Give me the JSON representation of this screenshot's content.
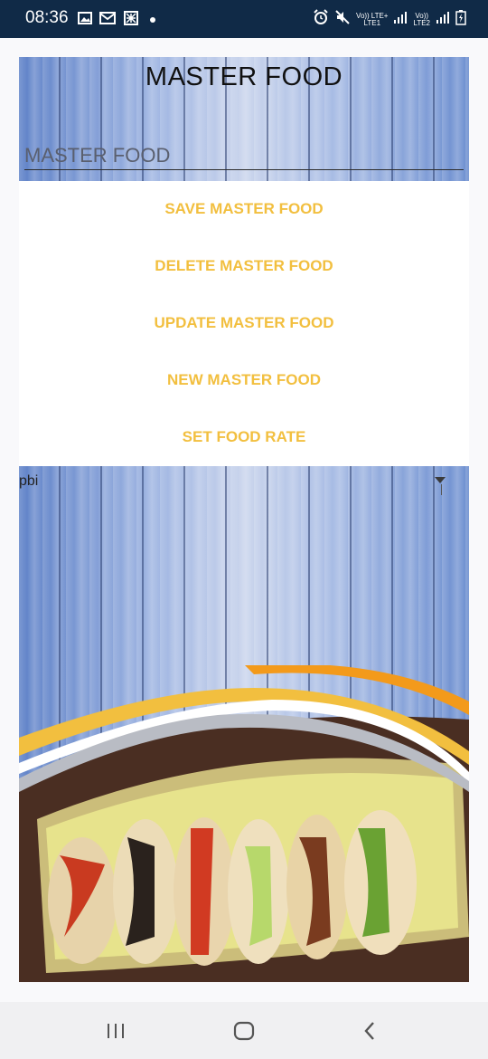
{
  "status_bar": {
    "time": "08:36",
    "icons": [
      "image-icon",
      "gmail-icon",
      "qr-icon",
      "dot-icon"
    ],
    "right_icons": [
      "alarm-icon",
      "mute-icon",
      "volte-lte1-icon",
      "signal-icon",
      "volte-lte2-icon",
      "signal-icon",
      "battery-charging-icon"
    ],
    "volte1_top": "Vo))",
    "volte1_mid": "LTE+",
    "volte1_bot": "LTE1",
    "volte2_top": "Vo))",
    "volte2_bot": "LTE2"
  },
  "header": {
    "title": "MASTER FOOD",
    "input_placeholder": "MASTER FOOD",
    "input_value": ""
  },
  "buttons": {
    "save": "SAVE MASTER FOOD",
    "delete": "DELETE MASTER FOOD",
    "update": "UPDATE MASTER FOOD",
    "new": "NEW MASTER FOOD",
    "rate": "SET FOOD RATE"
  },
  "spinner": {
    "selected": "pbi"
  },
  "colors": {
    "accent": "#f2bf3f",
    "status_bar": "#102a47",
    "wood": "#6f90cf"
  },
  "nav": {
    "recent_icon": "recent-apps-icon",
    "home_icon": "home-icon",
    "back_icon": "back-icon"
  }
}
